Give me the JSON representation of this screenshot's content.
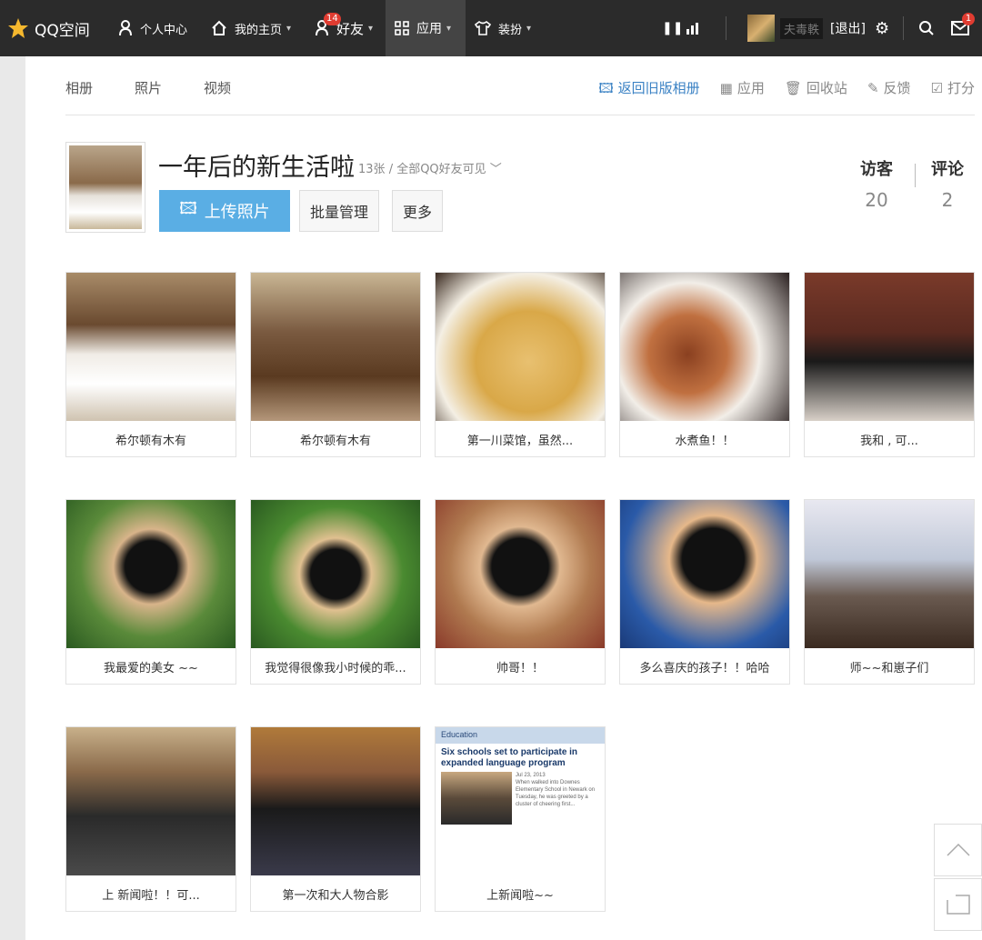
{
  "topbar": {
    "logo_text": "QQ空间",
    "personal_center": "个人中心",
    "homepage": "我的主页",
    "friends": "好友",
    "friends_badge": "14",
    "apps": "应用",
    "dress": "装扮",
    "username": "夫毒軼",
    "logout": "[退出]",
    "mail_badge": "1"
  },
  "subnav": {
    "albums": "相册",
    "photos": "照片",
    "videos": "视频"
  },
  "toolnav": {
    "old_album": "返回旧版相册",
    "apps": "应用",
    "recycle": "回收站",
    "feedback": "反馈",
    "rate": "打分"
  },
  "album": {
    "title": "一年后的新生活啦",
    "count": "13张",
    "visibility": "/ 全部QQ好友可见 ﹀",
    "upload": "上传照片",
    "manage": "批量管理",
    "more": "更多",
    "visitors_label": "访客",
    "visitors": "20",
    "comments_label": "评论",
    "comments": "2"
  },
  "photos": [
    {
      "caption": "希尔顿有木有"
    },
    {
      "caption": "希尔顿有木有"
    },
    {
      "caption": "第一川菜馆，虽然..."
    },
    {
      "caption": "水煮鱼！！"
    },
    {
      "caption": "我和 , 可..."
    },
    {
      "caption": "我最爱的美女 ~~"
    },
    {
      "caption": "我觉得很像我小时候的乖..."
    },
    {
      "caption": "帅哥！！"
    },
    {
      "caption": "多么喜庆的孩子！！哈哈"
    },
    {
      "caption": "师~~和崽子们"
    },
    {
      "caption": "上 新闻啦！！可..."
    },
    {
      "caption": "第一次和大人物合影"
    },
    {
      "caption": "上新闻啦~~"
    }
  ],
  "news": {
    "section": "Education",
    "headline": "Six schools set to participate in expanded language program",
    "date": "Jul 23, 2013",
    "body": "When walked into Downes Elementary School in Newark on Tuesday, he was greeted by a cluster of cheering first..."
  },
  "colors": {
    "topbar": "#2b2b2b",
    "accent": "#5aaee4",
    "link": "#3b82c4"
  }
}
